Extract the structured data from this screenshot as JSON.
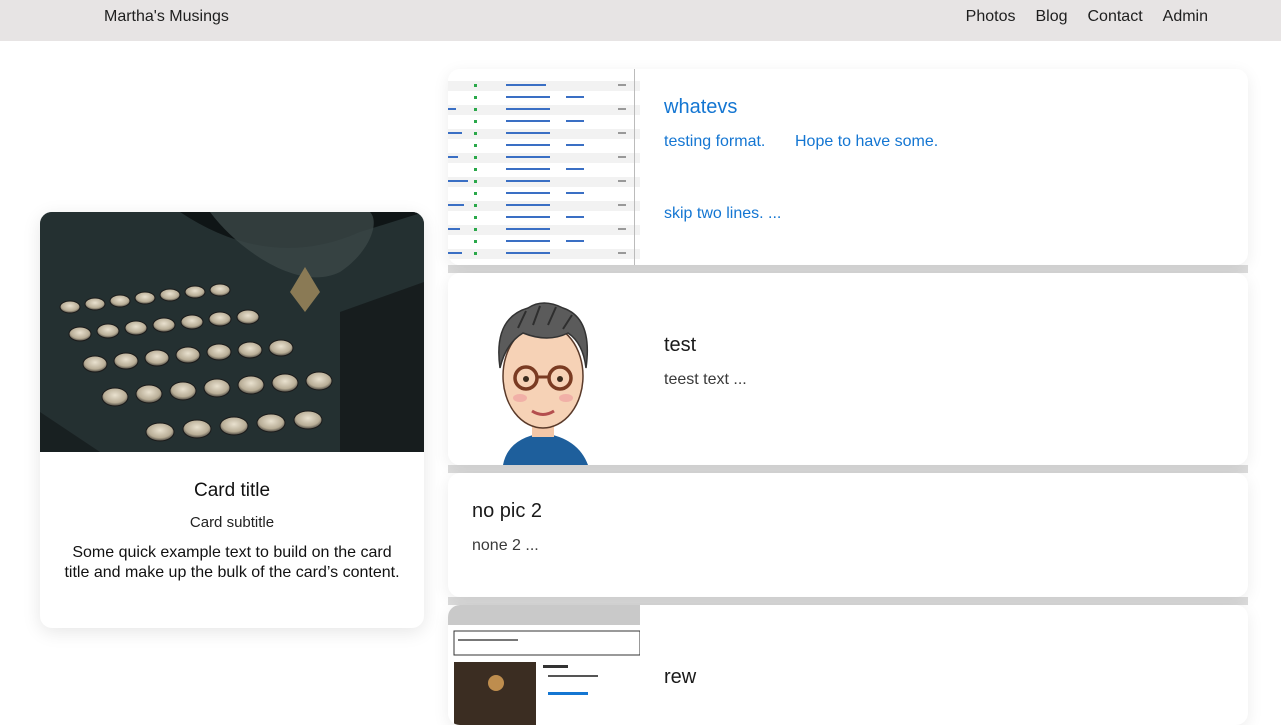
{
  "navbar": {
    "brand": "Martha's Musings",
    "links": [
      "Photos",
      "Blog",
      "Contact",
      "Admin"
    ]
  },
  "feature_card": {
    "title": "Card title",
    "subtitle": "Card subtitle",
    "text": "Some quick example text to build on the card title and make up the bulk of the card’s content."
  },
  "posts": [
    {
      "title": "whatevs",
      "line1a": "testing format.",
      "line1b": "Hope to have some.",
      "line2": "skip two lines. ..."
    },
    {
      "title": "test",
      "text": "teest text ..."
    },
    {
      "title": "no pic 2",
      "text": "none 2 ..."
    },
    {
      "title": "rew"
    }
  ],
  "colors": {
    "navbar_bg": "#e7e4e4",
    "link_blue": "#1476d2"
  }
}
